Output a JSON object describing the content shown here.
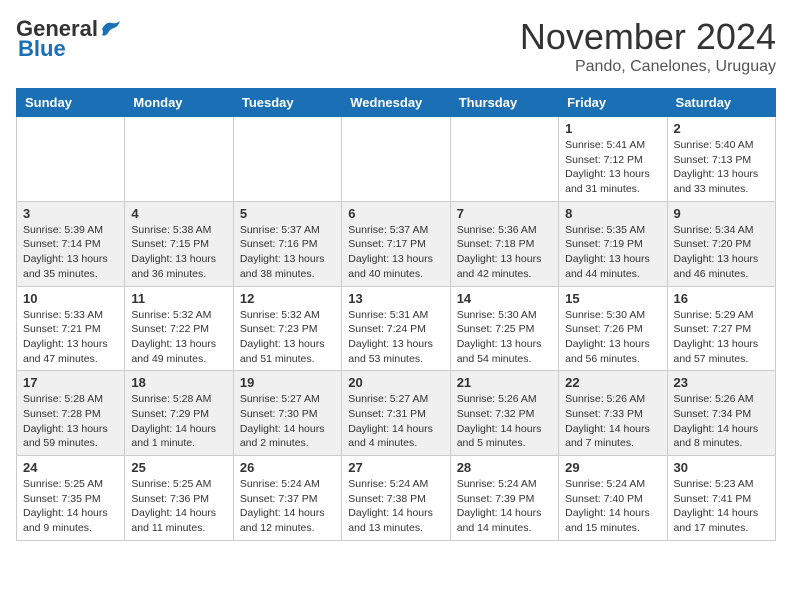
{
  "header": {
    "logo_general": "General",
    "logo_blue": "Blue",
    "month_title": "November 2024",
    "location": "Pando, Canelones, Uruguay"
  },
  "weekdays": [
    "Sunday",
    "Monday",
    "Tuesday",
    "Wednesday",
    "Thursday",
    "Friday",
    "Saturday"
  ],
  "weeks": [
    [
      {
        "day": "",
        "sunrise": "",
        "sunset": "",
        "daylight": ""
      },
      {
        "day": "",
        "sunrise": "",
        "sunset": "",
        "daylight": ""
      },
      {
        "day": "",
        "sunrise": "",
        "sunset": "",
        "daylight": ""
      },
      {
        "day": "",
        "sunrise": "",
        "sunset": "",
        "daylight": ""
      },
      {
        "day": "",
        "sunrise": "",
        "sunset": "",
        "daylight": ""
      },
      {
        "day": "1",
        "sunrise": "Sunrise: 5:41 AM",
        "sunset": "Sunset: 7:12 PM",
        "daylight": "Daylight: 13 hours and 31 minutes."
      },
      {
        "day": "2",
        "sunrise": "Sunrise: 5:40 AM",
        "sunset": "Sunset: 7:13 PM",
        "daylight": "Daylight: 13 hours and 33 minutes."
      }
    ],
    [
      {
        "day": "3",
        "sunrise": "Sunrise: 5:39 AM",
        "sunset": "Sunset: 7:14 PM",
        "daylight": "Daylight: 13 hours and 35 minutes."
      },
      {
        "day": "4",
        "sunrise": "Sunrise: 5:38 AM",
        "sunset": "Sunset: 7:15 PM",
        "daylight": "Daylight: 13 hours and 36 minutes."
      },
      {
        "day": "5",
        "sunrise": "Sunrise: 5:37 AM",
        "sunset": "Sunset: 7:16 PM",
        "daylight": "Daylight: 13 hours and 38 minutes."
      },
      {
        "day": "6",
        "sunrise": "Sunrise: 5:37 AM",
        "sunset": "Sunset: 7:17 PM",
        "daylight": "Daylight: 13 hours and 40 minutes."
      },
      {
        "day": "7",
        "sunrise": "Sunrise: 5:36 AM",
        "sunset": "Sunset: 7:18 PM",
        "daylight": "Daylight: 13 hours and 42 minutes."
      },
      {
        "day": "8",
        "sunrise": "Sunrise: 5:35 AM",
        "sunset": "Sunset: 7:19 PM",
        "daylight": "Daylight: 13 hours and 44 minutes."
      },
      {
        "day": "9",
        "sunrise": "Sunrise: 5:34 AM",
        "sunset": "Sunset: 7:20 PM",
        "daylight": "Daylight: 13 hours and 46 minutes."
      }
    ],
    [
      {
        "day": "10",
        "sunrise": "Sunrise: 5:33 AM",
        "sunset": "Sunset: 7:21 PM",
        "daylight": "Daylight: 13 hours and 47 minutes."
      },
      {
        "day": "11",
        "sunrise": "Sunrise: 5:32 AM",
        "sunset": "Sunset: 7:22 PM",
        "daylight": "Daylight: 13 hours and 49 minutes."
      },
      {
        "day": "12",
        "sunrise": "Sunrise: 5:32 AM",
        "sunset": "Sunset: 7:23 PM",
        "daylight": "Daylight: 13 hours and 51 minutes."
      },
      {
        "day": "13",
        "sunrise": "Sunrise: 5:31 AM",
        "sunset": "Sunset: 7:24 PM",
        "daylight": "Daylight: 13 hours and 53 minutes."
      },
      {
        "day": "14",
        "sunrise": "Sunrise: 5:30 AM",
        "sunset": "Sunset: 7:25 PM",
        "daylight": "Daylight: 13 hours and 54 minutes."
      },
      {
        "day": "15",
        "sunrise": "Sunrise: 5:30 AM",
        "sunset": "Sunset: 7:26 PM",
        "daylight": "Daylight: 13 hours and 56 minutes."
      },
      {
        "day": "16",
        "sunrise": "Sunrise: 5:29 AM",
        "sunset": "Sunset: 7:27 PM",
        "daylight": "Daylight: 13 hours and 57 minutes."
      }
    ],
    [
      {
        "day": "17",
        "sunrise": "Sunrise: 5:28 AM",
        "sunset": "Sunset: 7:28 PM",
        "daylight": "Daylight: 13 hours and 59 minutes."
      },
      {
        "day": "18",
        "sunrise": "Sunrise: 5:28 AM",
        "sunset": "Sunset: 7:29 PM",
        "daylight": "Daylight: 14 hours and 1 minute."
      },
      {
        "day": "19",
        "sunrise": "Sunrise: 5:27 AM",
        "sunset": "Sunset: 7:30 PM",
        "daylight": "Daylight: 14 hours and 2 minutes."
      },
      {
        "day": "20",
        "sunrise": "Sunrise: 5:27 AM",
        "sunset": "Sunset: 7:31 PM",
        "daylight": "Daylight: 14 hours and 4 minutes."
      },
      {
        "day": "21",
        "sunrise": "Sunrise: 5:26 AM",
        "sunset": "Sunset: 7:32 PM",
        "daylight": "Daylight: 14 hours and 5 minutes."
      },
      {
        "day": "22",
        "sunrise": "Sunrise: 5:26 AM",
        "sunset": "Sunset: 7:33 PM",
        "daylight": "Daylight: 14 hours and 7 minutes."
      },
      {
        "day": "23",
        "sunrise": "Sunrise: 5:26 AM",
        "sunset": "Sunset: 7:34 PM",
        "daylight": "Daylight: 14 hours and 8 minutes."
      }
    ],
    [
      {
        "day": "24",
        "sunrise": "Sunrise: 5:25 AM",
        "sunset": "Sunset: 7:35 PM",
        "daylight": "Daylight: 14 hours and 9 minutes."
      },
      {
        "day": "25",
        "sunrise": "Sunrise: 5:25 AM",
        "sunset": "Sunset: 7:36 PM",
        "daylight": "Daylight: 14 hours and 11 minutes."
      },
      {
        "day": "26",
        "sunrise": "Sunrise: 5:24 AM",
        "sunset": "Sunset: 7:37 PM",
        "daylight": "Daylight: 14 hours and 12 minutes."
      },
      {
        "day": "27",
        "sunrise": "Sunrise: 5:24 AM",
        "sunset": "Sunset: 7:38 PM",
        "daylight": "Daylight: 14 hours and 13 minutes."
      },
      {
        "day": "28",
        "sunrise": "Sunrise: 5:24 AM",
        "sunset": "Sunset: 7:39 PM",
        "daylight": "Daylight: 14 hours and 14 minutes."
      },
      {
        "day": "29",
        "sunrise": "Sunrise: 5:24 AM",
        "sunset": "Sunset: 7:40 PM",
        "daylight": "Daylight: 14 hours and 15 minutes."
      },
      {
        "day": "30",
        "sunrise": "Sunrise: 5:23 AM",
        "sunset": "Sunset: 7:41 PM",
        "daylight": "Daylight: 14 hours and 17 minutes."
      }
    ]
  ]
}
